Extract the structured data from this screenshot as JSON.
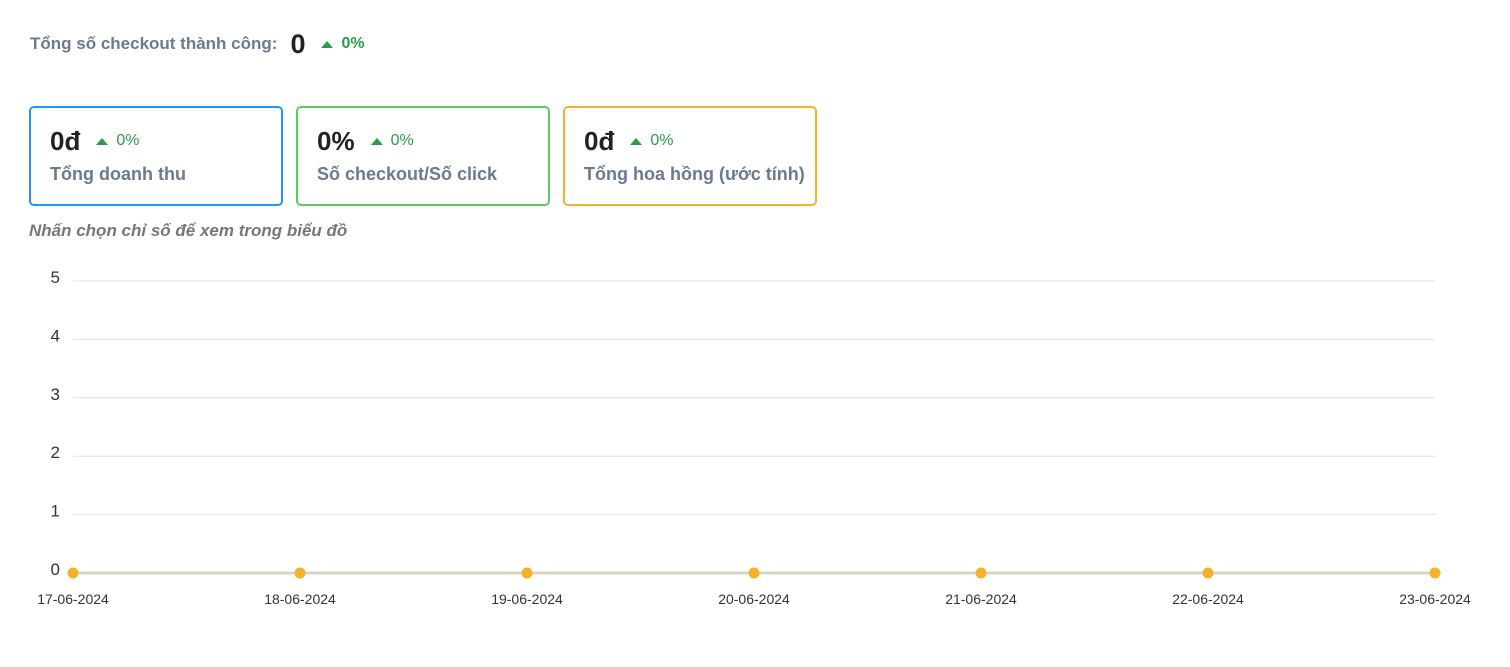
{
  "summary": {
    "label": "Tổng số checkout thành công:",
    "value": "0",
    "change": "0%"
  },
  "cards": [
    {
      "value": "0đ",
      "change": "0%",
      "label": "Tổng doanh thu",
      "color": "#2196f3"
    },
    {
      "value": "0%",
      "change": "0%",
      "label": "Số checkout/Số click",
      "color": "#5cc96b"
    },
    {
      "value": "0đ",
      "change": "0%",
      "label": "Tổng hoa hồng (ước tính)",
      "color": "#f5b12a"
    }
  ],
  "hint": "Nhấn chọn chỉ số để xem trong biểu đồ",
  "chart_data": {
    "type": "line",
    "title": "",
    "xlabel": "",
    "ylabel": "",
    "x": [
      "17-06-2024",
      "18-06-2024",
      "19-06-2024",
      "20-06-2024",
      "21-06-2024",
      "22-06-2024",
      "23-06-2024"
    ],
    "series": [
      {
        "values": [
          0,
          0,
          0,
          0,
          0,
          0,
          0
        ],
        "color": "#f5b12a"
      }
    ],
    "ylim": [
      0,
      5
    ],
    "yticks": [
      "0",
      "1",
      "2",
      "3",
      "4",
      "5"
    ],
    "grid": true
  }
}
